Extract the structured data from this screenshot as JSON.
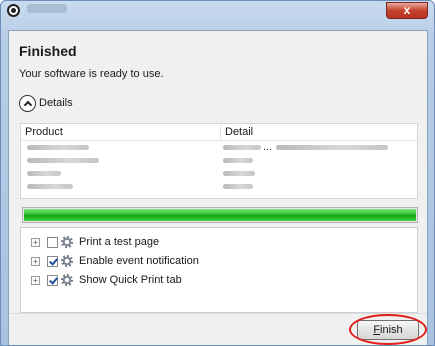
{
  "window": {
    "close_symbol": "x"
  },
  "page": {
    "title": "Finished",
    "subtitle": "Your software is ready to use.",
    "details_toggle_label": "Details"
  },
  "product_table": {
    "columns": [
      "Product",
      "Detail"
    ],
    "rows": [
      {
        "detail_ellipsis": "..."
      },
      {},
      {},
      {}
    ]
  },
  "progress": {
    "value_percent": 100,
    "color": "#1fb31f"
  },
  "options": [
    {
      "label": "Print a test page",
      "checked": false,
      "icon": "gear-icon"
    },
    {
      "label": "Enable event notification",
      "checked": true,
      "icon": "gear-icon"
    },
    {
      "label": "Show Quick Print tab",
      "checked": true,
      "icon": "gear-icon"
    }
  ],
  "footer": {
    "finish_label_mnemonic": "F",
    "finish_label_rest": "inish",
    "highlight_color": "#e0201a"
  }
}
